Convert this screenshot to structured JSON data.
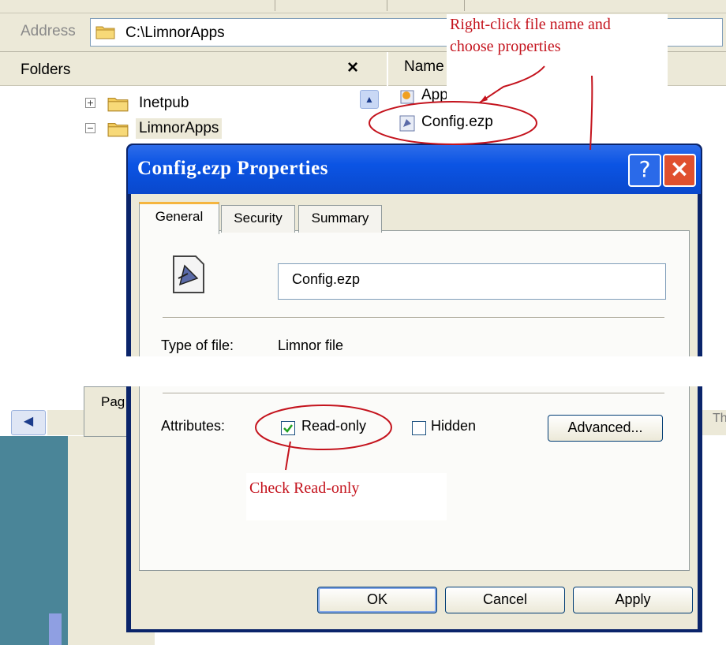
{
  "address": {
    "label": "Address",
    "path": "C:\\LimnorApps"
  },
  "folders": {
    "title": "Folders",
    "close": "×",
    "items": [
      {
        "label": "Inetpub",
        "expander": "+"
      },
      {
        "label": "LimnorApps",
        "expander": "−"
      }
    ]
  },
  "list": {
    "column_name": "Name",
    "items": [
      {
        "label": "App"
      },
      {
        "label": "Config.ezp"
      }
    ]
  },
  "bottom": {
    "tab_label": "Pag",
    "right_text": "Th"
  },
  "dialog": {
    "title": "Config.ezp Properties",
    "help": "?",
    "close": "×",
    "tabs": [
      "General",
      "Security",
      "Summary"
    ],
    "file_name": "Config.ezp",
    "type_label": "Type of file:",
    "type_value": "Limnor file",
    "attributes_label": "Attributes:",
    "readonly_label": "Read-only",
    "readonly_checked": true,
    "hidden_label": "Hidden",
    "hidden_checked": false,
    "advanced_button": "Advanced...",
    "ok_button": "OK",
    "cancel_button": "Cancel",
    "apply_button": "Apply"
  },
  "annotations": {
    "top_line1": "Right-click file name and",
    "top_line2": "choose properties",
    "check_note": "Check Read-only",
    "color": "#c4131d"
  }
}
